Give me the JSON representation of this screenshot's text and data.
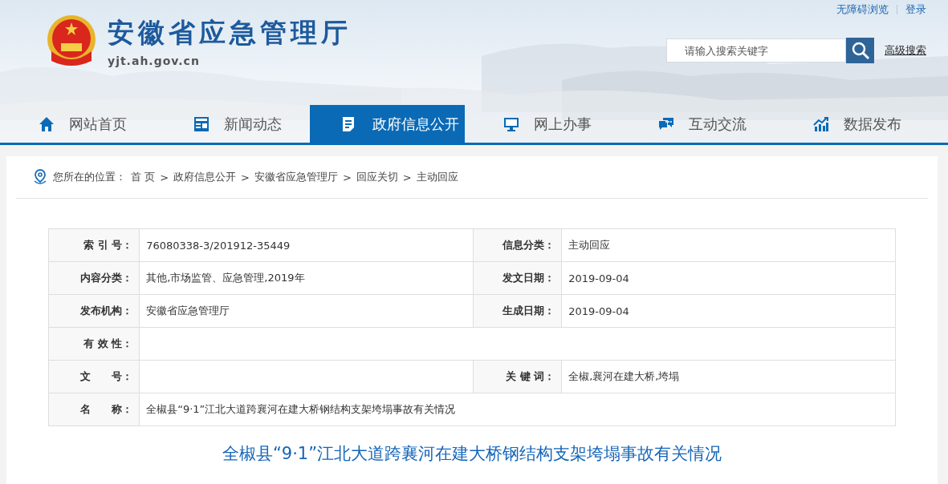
{
  "header": {
    "title": "安徽省应急管理厅",
    "url": "yjt.ah.gov.cn",
    "top_links": [
      "无障碍浏览",
      "登录"
    ],
    "search": {
      "placeholder": "请输入搜索关键字"
    },
    "advanced_search": "高级搜索"
  },
  "nav": [
    {
      "label": "网站首页",
      "selected": false
    },
    {
      "label": "新闻动态",
      "selected": false
    },
    {
      "label": "政府信息公开",
      "selected": true
    },
    {
      "label": "网上办事",
      "selected": false
    },
    {
      "label": "互动交流",
      "selected": false
    },
    {
      "label": "数据发布",
      "selected": false
    }
  ],
  "breadcrumb": {
    "prefix": "您所在的位置：",
    "separator": ">",
    "items": [
      "首 页",
      "政府信息公开",
      "安徽省应急管理厅",
      "回应关切",
      "主动回应"
    ]
  },
  "info_table": [
    {
      "cells": [
        {
          "label": "索 引 号：",
          "value": "76080338-3/201912-35449"
        },
        {
          "label": "信息分类：",
          "value": "主动回应"
        }
      ]
    },
    {
      "cells": [
        {
          "label": "内容分类：",
          "value": "其他,市场监管、应急管理,2019年"
        },
        {
          "label": "发文日期：",
          "value": "2019-09-04"
        }
      ]
    },
    {
      "cells": [
        {
          "label": "发布机构：",
          "value": "安徽省应急管理厅"
        },
        {
          "label": "生成日期：",
          "value": "2019-09-04"
        }
      ]
    },
    {
      "cells": [
        {
          "label": "有 效 性："
        }
      ]
    },
    {
      "cells": [
        {
          "label": "文　　号："
        },
        {
          "label": "关 键 词：",
          "value": "全椒,襄河在建大桥,垮塌"
        }
      ]
    },
    {
      "cells": [
        {
          "label": "名　　称：",
          "value": "全椒县“9·1”江北大道跨襄河在建大桥钢结构支架垮塌事故有关情况"
        }
      ]
    }
  ],
  "article_title": "全椒县“9·1”江北大道跨襄河在建大桥钢结构支架垮塌事故有关情况"
}
